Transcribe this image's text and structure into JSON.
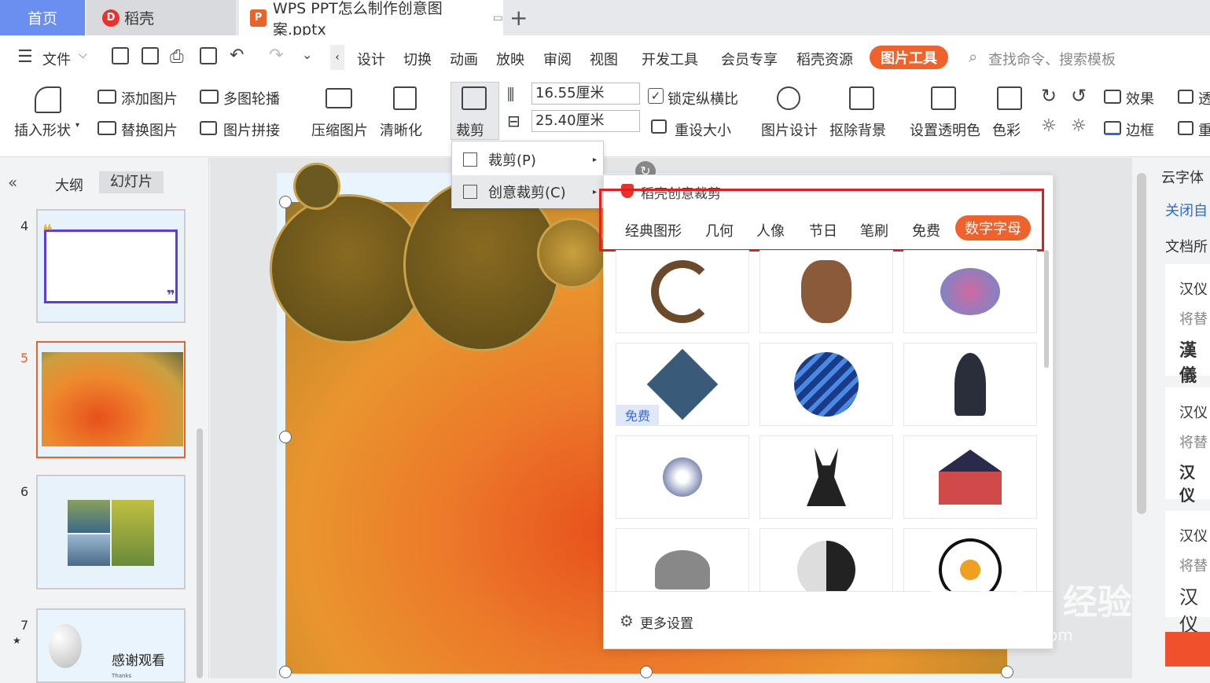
{
  "tabs": {
    "home": "首页",
    "daoke": "稻壳",
    "doc": "WPS PPT怎么制作创意图案.pptx"
  },
  "menu": {
    "file": "文件",
    "items": [
      "设计",
      "切换",
      "动画",
      "放映",
      "审阅",
      "视图",
      "开发工具",
      "会员专享",
      "稻壳资源"
    ],
    "picture_tools": "图片工具",
    "search_placeholder": "查找命令、搜索模板"
  },
  "ribbon": {
    "insert_shape": "插入形状",
    "add_picture": "添加图片",
    "replace_picture": "替换图片",
    "multi_carousel": "多图轮播",
    "picture_collage": "图片拼接",
    "compress": "压缩图片",
    "clarify": "清晰化",
    "crop": "裁剪",
    "width": "16.55厘米",
    "height": "25.40厘米",
    "lock_ratio": "锁定纵横比",
    "reset_size": "重设大小",
    "picture_design": "图片设计",
    "remove_bg": "抠除背景",
    "set_transparent": "设置透明色",
    "color": "色彩",
    "effect": "效果",
    "border": "边框",
    "trans": "透",
    "re": "重"
  },
  "left_panel": {
    "outline_tab": "大纲",
    "slides_tab": "幻灯片",
    "slide_numbers": [
      "4",
      "5",
      "6",
      "7"
    ],
    "slide7_title": "感谢观看",
    "slide7_sub": "Thanks"
  },
  "crop_menu": {
    "crop": "裁剪(P)",
    "creative_crop": "创意裁剪(C)"
  },
  "creative_panel": {
    "title": "稻壳创意裁剪",
    "categories": [
      "经典图形",
      "几何",
      "人像",
      "节日",
      "笔刷",
      "免费"
    ],
    "active_category": "数字字母",
    "free_badge": "免费",
    "more_settings": "更多设置"
  },
  "right_panel": {
    "cloud_font": "云字体",
    "close": "关闭自",
    "doc_fonts": "文档所",
    "card1": {
      "name": "汉仪",
      "replace": "将替",
      "sample": "漢儀"
    },
    "card2": {
      "name": "汉仪",
      "replace": "将替",
      "sample": "汉仪"
    },
    "card3": {
      "name": "汉仪",
      "replace": "将替",
      "sample": "汉仪"
    }
  },
  "watermark": {
    "logo": "Bai du 经验",
    "url": "jingyan.baidu.com"
  },
  "colors": {
    "accent": "#f0622b",
    "highlight_box": "#e0201f",
    "home_tab": "#6b8ff0"
  }
}
